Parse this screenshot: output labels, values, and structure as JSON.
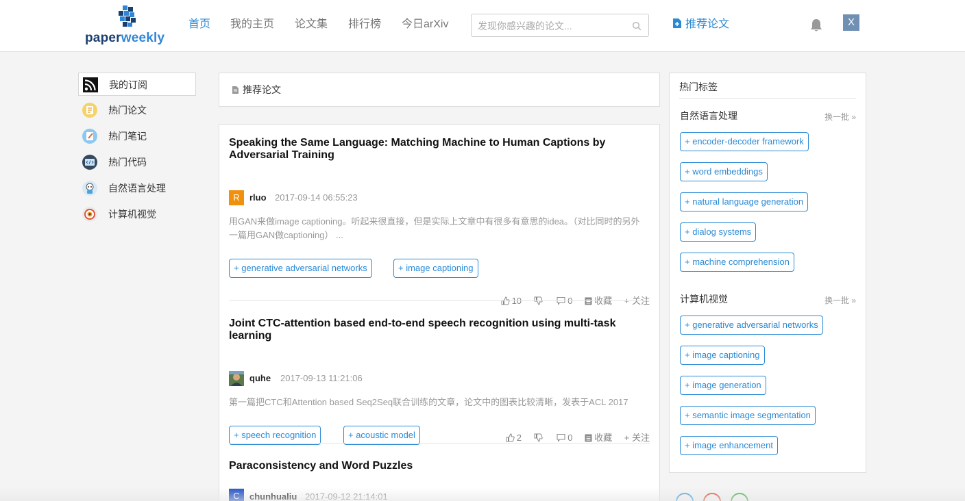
{
  "header": {
    "logo_part1": "paper",
    "logo_part2": "weekly",
    "nav": [
      "首页",
      "我的主页",
      "论文集",
      "排行榜",
      "今日arXiv"
    ],
    "search_placeholder": "发现你感兴趣的论文...",
    "recommend_label": "推荐论文",
    "avatar_letter": "X"
  },
  "sidebar": {
    "items": [
      {
        "label": "我的订阅",
        "icon": "rss-icon"
      },
      {
        "label": "热门论文",
        "icon": "paper-icon"
      },
      {
        "label": "热门笔记",
        "icon": "note-icon"
      },
      {
        "label": "热门代码",
        "icon": "code-icon"
      },
      {
        "label": "自然语言处理",
        "icon": "robot-icon"
      },
      {
        "label": "计算机视觉",
        "icon": "eye-icon"
      }
    ]
  },
  "main": {
    "header_label": "推荐论文",
    "papers": [
      {
        "title": "Speaking the Same Language: Matching Machine to Human Captions by Adversarial Training",
        "avatar": "R",
        "author": "rluo",
        "time": "2017-09-14 06:55:23",
        "abstract": "用GAN来做image captioning。听起来很直接，但是实际上文章中有很多有意思的idea。（对比同时的另外一篇用GAN做captioning） ...",
        "tags": [
          "+ generative adversarial networks",
          "+ image captioning"
        ],
        "likes": "10",
        "comments": "0",
        "collect": "收藏",
        "follow": "+ 关注"
      },
      {
        "title": "Joint CTC-attention based end-to-end speech recognition using multi-task learning",
        "avatar": "",
        "author": "quhe",
        "time": "2017-09-13 11:21:06",
        "abstract": "第一篇把CTC和Attention based Seq2Seq联合训练的文章，论文中的图表比较清晰，发表于ACL 2017",
        "tags": [
          "+ speech recognition",
          "+ acoustic model"
        ],
        "likes": "2",
        "comments": "0",
        "collect": "收藏",
        "follow": "+ 关注"
      },
      {
        "title": "Paraconsistency and Word Puzzles",
        "avatar": "C",
        "author": "chunhualiu",
        "time": "2017-09-12 21:14:01"
      }
    ]
  },
  "hot_tags": {
    "title": "热门标签",
    "sections": [
      {
        "name": "自然语言处理",
        "more": "换一批 »",
        "tags": [
          "+ encoder-decoder framework",
          "+ word embeddings",
          "+ natural language generation",
          "+ dialog systems",
          "+ machine comprehension"
        ]
      },
      {
        "name": "计算机视觉",
        "more": "换一批 »",
        "tags": [
          "+ generative adversarial networks",
          "+ image captioning",
          "+ image generation",
          "+ semantic image segmentation",
          "+ image enhancement"
        ]
      }
    ]
  },
  "colors": {
    "accent": "#2a8ad6",
    "logo_dark": "#1a3e6e",
    "avatar_r": "#f0900d",
    "avatar_c": "#2352c4"
  }
}
